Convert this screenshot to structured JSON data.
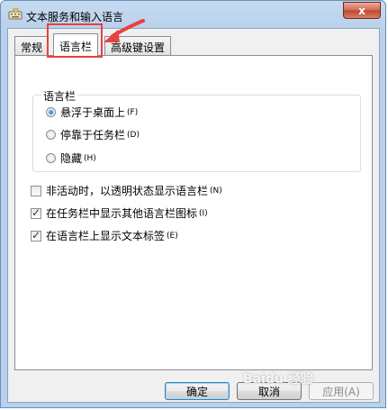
{
  "window": {
    "title": "文本服务和输入语言",
    "close_glyph": "x"
  },
  "tabs": [
    {
      "label": "常规",
      "active": false
    },
    {
      "label": "语言栏",
      "active": true
    },
    {
      "label": "高级键设置",
      "active": false
    }
  ],
  "language_bar_group": {
    "title": "语言栏",
    "options": [
      {
        "label": "悬浮于桌面上",
        "shortcut": "(F)",
        "checked": true
      },
      {
        "label": "停靠于任务栏",
        "shortcut": "(D)",
        "checked": false
      },
      {
        "label": "隐藏",
        "shortcut": "(H)",
        "checked": false
      }
    ]
  },
  "checkboxes": [
    {
      "label": "非活动时，以透明状态显示语言栏",
      "shortcut": "(N)",
      "checked": false
    },
    {
      "label": "在任务栏中显示其他语言栏图标",
      "shortcut": "(I)",
      "checked": true
    },
    {
      "label": "在语言栏上显示文本标签",
      "shortcut": "(E)",
      "checked": true
    }
  ],
  "buttons": {
    "ok": "确定",
    "cancel": "取消",
    "apply": "应用(A)"
  },
  "watermark": "Baidu 经验",
  "colors": {
    "annotation": "#e8413e",
    "frame": "#b9d1ea",
    "close": "#c4452c"
  }
}
